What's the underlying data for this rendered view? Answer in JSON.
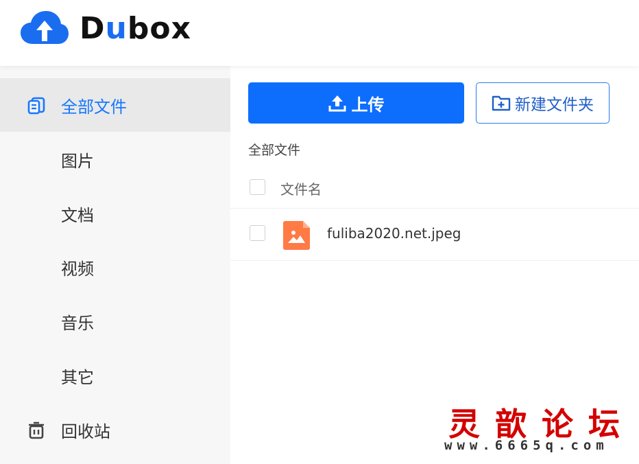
{
  "header": {
    "logo_text_d": "D",
    "logo_text_u": "u",
    "logo_text_rest": "box",
    "logo_icon": "cloud-upload-icon",
    "brand_color": "#1b6df0"
  },
  "sidebar": {
    "items": [
      {
        "label": "全部文件",
        "icon": "files-icon",
        "active": true
      },
      {
        "label": "图片"
      },
      {
        "label": "文档"
      },
      {
        "label": "视频"
      },
      {
        "label": "音乐"
      },
      {
        "label": "其它"
      },
      {
        "label": "回收站",
        "icon": "trash-icon"
      }
    ],
    "active_color": "#1677ff"
  },
  "toolbar": {
    "upload_label": "上传",
    "upload_icon": "upload-icon",
    "new_folder_label": "新建文件夹",
    "new_folder_icon": "folder-plus-icon",
    "primary_color": "#0d6efd"
  },
  "breadcrumb": "全部文件",
  "file_list": {
    "column_name": "文件名",
    "rows": [
      {
        "name": "fuliba2020.net.jpeg",
        "icon": "image-file-icon",
        "icon_color": "#ff7a45"
      }
    ]
  },
  "watermark": {
    "title": "灵歆论坛",
    "url": "www.6665q.com",
    "title_color": "#d40000"
  }
}
